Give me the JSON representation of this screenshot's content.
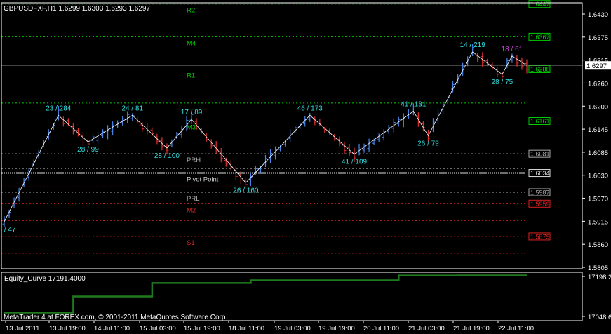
{
  "header": {
    "symbol_line": "GBPUSDFXF,H1  1.6299 1.6303 1.6293 1.6297"
  },
  "indicator": {
    "label": "Equity_Curve 17191.4000"
  },
  "footer": {
    "copyright": "MetaTrader 4 at FOREX.com, © 2001-2011 MetaQuotes Software Corp."
  },
  "colors": {
    "background": "#000000",
    "axis": "#ffffff",
    "bull_bar": "#4a86e8",
    "bear_bar": "#e03030",
    "zigzag": "#ffffff",
    "zigzag_label": "#33dddd",
    "green_level": "#00cc00",
    "red_level": "#dd2222",
    "gray_level": "#aaaaaa",
    "equity": "#1f7a1f"
  },
  "chart_data": [
    {
      "type": "line",
      "title": "GBPUSDFXF,H1",
      "ylim": [
        1.58,
        1.645
      ],
      "y_ticks": [
        "1.6430",
        "1.6375",
        "1.6315",
        "1.6260",
        "1.6200",
        "1.6145",
        "1.6085",
        "1.6030",
        "1.5970",
        "1.5915",
        "1.5860",
        "1.5805"
      ],
      "x_labels": [
        "13 Jul 2011",
        "13 Jul 19:00",
        "14 Jul 11:00",
        "15 Jul 03:00",
        "15 Jul 19:00",
        "18 Jul 11:00",
        "19 Jul 03:00",
        "19 Jul 19:00",
        "20 Jul 11:00",
        "21 Jul 03:00",
        "21 Jul 19:00",
        "22 Jul 11:00"
      ],
      "current_price": "1.6297",
      "levels": [
        {
          "name": "R2",
          "price": 1.6447,
          "label": "1.6447",
          "color": "green"
        },
        {
          "name": "M4",
          "price": 1.6367,
          "label": "1.6367",
          "color": "green"
        },
        {
          "name": "R1",
          "price": 1.6288,
          "label": "1.6288",
          "color": "green"
        },
        {
          "name": "",
          "price": 1.6205,
          "label": "",
          "color": "green"
        },
        {
          "name": "M3",
          "price": 1.6161,
          "label": "1.6161",
          "color": "green"
        },
        {
          "name": "PRH",
          "price": 1.6081,
          "label": "1.6081",
          "color": "gray"
        },
        {
          "name": "",
          "price": 1.6045,
          "label": "",
          "color": "gray"
        },
        {
          "name": "Pivot Point",
          "price": 1.6034,
          "label": "1.6034",
          "color": "white"
        },
        {
          "name": "",
          "price": 1.6,
          "label": "",
          "color": "red"
        },
        {
          "name": "PRL",
          "price": 1.5987,
          "label": "1.5987",
          "color": "gray"
        },
        {
          "name": "M2",
          "price": 1.5959,
          "label": "1.5959",
          "color": "red"
        },
        {
          "name": "",
          "price": 1.5918,
          "label": "",
          "color": "red"
        },
        {
          "name": "S1",
          "price": 1.5879,
          "label": "1.5879",
          "color": "red"
        },
        {
          "name": "",
          "price": 1.5838,
          "label": "",
          "color": "red"
        }
      ],
      "zigzag": [
        {
          "i": 0,
          "p": 1.5915,
          "label": "/ 47"
        },
        {
          "i": 11,
          "p": 1.6175,
          "label": "23 / 284"
        },
        {
          "i": 17,
          "p": 1.611,
          "label": "28 / 99"
        },
        {
          "i": 26,
          "p": 1.6175,
          "label": "24 / 81"
        },
        {
          "i": 33,
          "p": 1.6095,
          "label": "28 / 100"
        },
        {
          "i": 38,
          "p": 1.6165,
          "label": "17 / 89"
        },
        {
          "i": 49,
          "p": 1.601,
          "label": "26 / 160"
        },
        {
          "i": 62,
          "p": 1.6175,
          "label": "46 / 173"
        },
        {
          "i": 71,
          "p": 1.608,
          "label": "41 / 109"
        },
        {
          "i": 83,
          "p": 1.6185,
          "label": "41 / 131"
        },
        {
          "i": 86,
          "p": 1.6125,
          "label": "26 / 79"
        },
        {
          "i": 95,
          "p": 1.633,
          "label": "14 / 219"
        },
        {
          "i": 101,
          "p": 1.6275,
          "label": "28 / 75"
        },
        {
          "i": 103,
          "p": 1.632,
          "label": "18 / 61"
        },
        {
          "i": 106,
          "p": 1.6297,
          "label": ""
        }
      ]
    },
    {
      "type": "line",
      "title": "Equity_Curve 17191.4000",
      "y_ticks": [
        "17198.2",
        "17048.66"
      ],
      "ylim": [
        17030,
        17210
      ],
      "x": [
        0,
        14,
        30,
        50,
        80,
        92,
        106
      ],
      "values": [
        17060,
        17120,
        17170,
        17180,
        17198,
        17198.2,
        17198.2
      ]
    }
  ]
}
